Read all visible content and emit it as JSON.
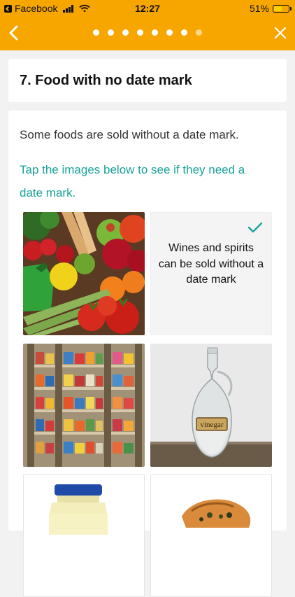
{
  "status_bar": {
    "back_app": "Facebook",
    "time": "12:27",
    "battery": "51%"
  },
  "nav": {
    "progress_total": 8,
    "progress_current": 8,
    "back_icon": "chevron-left-icon",
    "close_icon": "close-icon"
  },
  "title": "7. Food with no date mark",
  "intro": "Some foods are sold without a date mark.",
  "instruction": "Tap the images below to see if they need a date mark.",
  "tiles": [
    {
      "name": "fruit-vegetables",
      "revealed": false
    },
    {
      "name": "wines-spirits",
      "revealed": true,
      "text": "Wines and spirits can be sold without a date mark"
    },
    {
      "name": "frozen-food",
      "revealed": false
    },
    {
      "name": "vinegar",
      "revealed": false,
      "label": "vinegar"
    },
    {
      "name": "mayonnaise",
      "revealed": false
    },
    {
      "name": "pastry",
      "revealed": false
    }
  ],
  "colors": {
    "brand": "#f7a600",
    "accent_text": "#1aa39a"
  }
}
